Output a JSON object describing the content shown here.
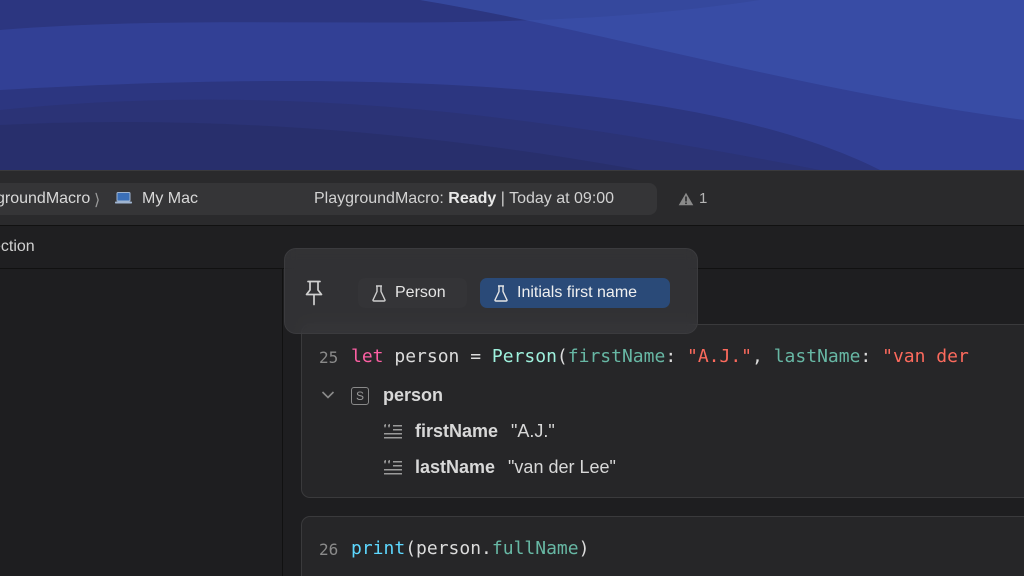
{
  "toolbar": {
    "project_crumb": "groundMacro",
    "crumb_separator": "⟩",
    "destination": "My Mac",
    "status_project": "PlaygroundMacro: ",
    "status_state": "Ready",
    "status_time": " | Today at 09:00",
    "warning_count": "1"
  },
  "tab": {
    "label": "ection"
  },
  "macro_toolbar": {
    "chips": [
      {
        "label": "Person",
        "selected": false
      },
      {
        "label": "Initials first name",
        "selected": true
      }
    ]
  },
  "cells": [
    {
      "line": "25",
      "tokens": [
        {
          "text": "let",
          "kind": "keyword"
        },
        {
          "text": " person = ",
          "kind": "plain"
        },
        {
          "text": "Person",
          "kind": "type"
        },
        {
          "text": "(",
          "kind": "plain"
        },
        {
          "text": "firstName",
          "kind": "label"
        },
        {
          "text": ": ",
          "kind": "plain"
        },
        {
          "text": "\"A.J.\"",
          "kind": "string"
        },
        {
          "text": ", ",
          "kind": "plain"
        },
        {
          "text": "lastName",
          "kind": "label"
        },
        {
          "text": ": ",
          "kind": "plain"
        },
        {
          "text": "\"van der",
          "kind": "string"
        }
      ],
      "result": {
        "struct_badge": "S",
        "name": "person",
        "fields": [
          {
            "name": "firstName",
            "value": "\"A.J.\""
          },
          {
            "name": "lastName",
            "value": "\"van der Lee\""
          }
        ]
      }
    },
    {
      "line": "26",
      "tokens": [
        {
          "text": "print",
          "kind": "function"
        },
        {
          "text": "(person.",
          "kind": "plain"
        },
        {
          "text": "fullName",
          "kind": "label"
        },
        {
          "text": ")",
          "kind": "plain"
        }
      ]
    }
  ],
  "colors": {
    "keyword": "#fc5fa3",
    "type": "#9ef1dd",
    "label": "#67b7a4",
    "string": "#fc6a5d",
    "function": "#5dd8ff",
    "selected_chip": "#2a4a78"
  },
  "icons": [
    "laptop-icon",
    "warning-icon",
    "pin-icon",
    "flask-icon",
    "chevron-down-icon",
    "struct-icon",
    "property-icon"
  ]
}
